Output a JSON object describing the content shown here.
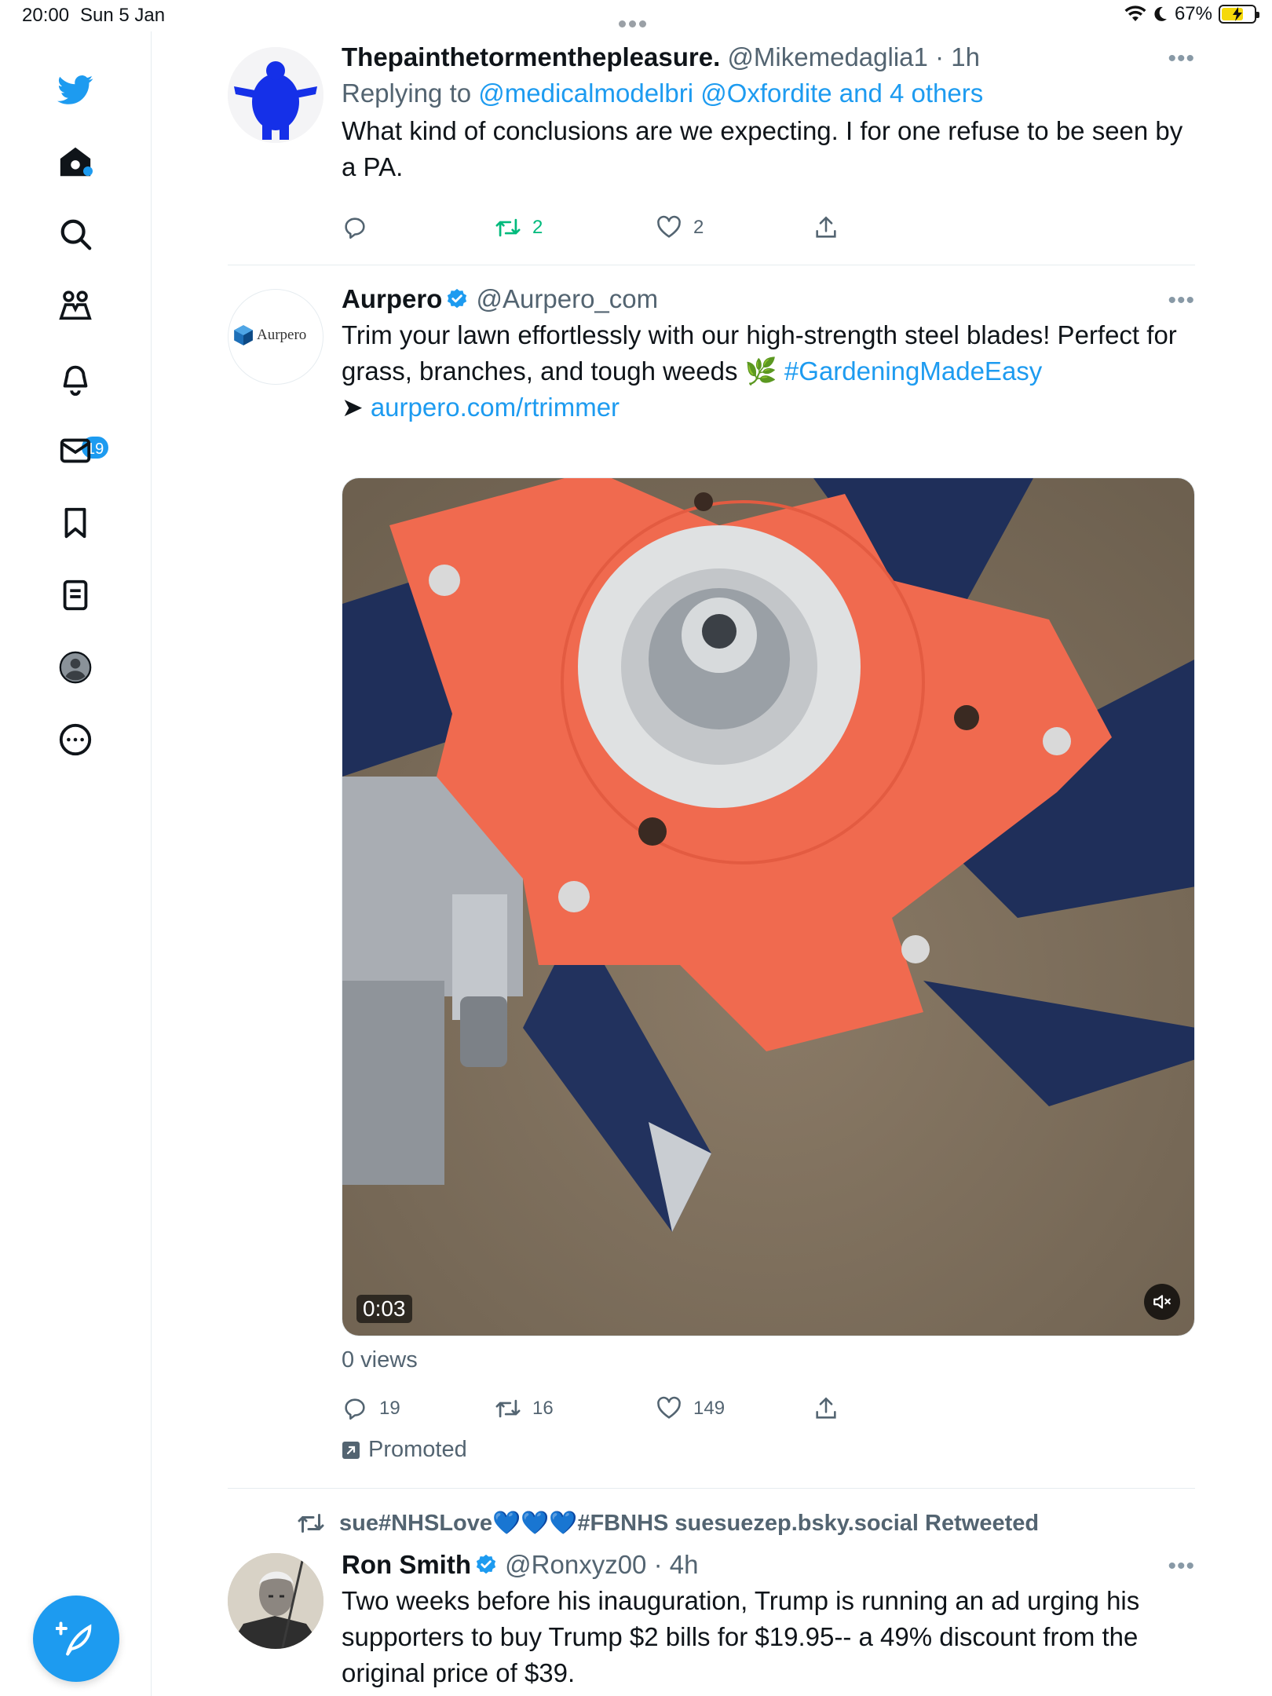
{
  "status_bar": {
    "time": "20:00",
    "date": "Sun 5 Jan",
    "battery": "67%",
    "battery_level": 0.67
  },
  "sidebar": {
    "items": [
      {
        "name": "logo",
        "icon": "twitter-bird-icon"
      },
      {
        "name": "home",
        "icon": "home-icon",
        "has_dot": true
      },
      {
        "name": "explore",
        "icon": "search-icon"
      },
      {
        "name": "communities",
        "icon": "communities-icon"
      },
      {
        "name": "notifications",
        "icon": "bell-icon",
        "badge": "19"
      },
      {
        "name": "messages",
        "icon": "mail-icon"
      },
      {
        "name": "bookmarks",
        "icon": "bookmark-icon"
      },
      {
        "name": "lists",
        "icon": "lists-icon"
      },
      {
        "name": "profile",
        "icon": "profile-icon"
      },
      {
        "name": "more",
        "icon": "more-circle-icon"
      }
    ],
    "compose_icon": "compose-feather-icon"
  },
  "tweets": [
    {
      "name": "Thepainthetormenthepleasure.",
      "handle": "@Mikemedaglia1",
      "time": "· 1h",
      "reply_prefix": "Replying to",
      "reply_targets": "@medicalmodelbri @Oxfordite and 4 others",
      "text": "What kind of conclusions are we expecting. I for one refuse to be seen by a PA.",
      "replies": "",
      "retweets": "2",
      "likes": "2"
    },
    {
      "name": "Aurpero",
      "avatar_text": "Aurpero",
      "handle": "@Aurpero_com",
      "text_1": "Trim your lawn effortlessly with our high-strength steel blades! Perfect for grass, branches, and tough weeds 🌿",
      "hashtag": "#GardeningMadeEasy",
      "arrow": "➤",
      "link": "aurpero.com/rtrimmer",
      "video_time": "0:03",
      "views": "0 views",
      "replies": "19",
      "retweets": "16",
      "likes": "149",
      "promoted": "Promoted"
    },
    {
      "retweeted_by": "sue#NHSLove💙💙💙#FBNHS suesuezep.bsky.social Retweeted",
      "name": "Ron Smith",
      "handle": "@Ronxyz00",
      "time": "· 4h",
      "text": "Two weeks before his inauguration, Trump is running an ad urging his supporters to buy Trump $2 bills for $19.95-- a 49% discount from the original price of $39."
    }
  ],
  "colors": {
    "accent": "#1d9bf0",
    "retweet_green": "#00ba7c",
    "secondary_text": "#536471",
    "divider": "#e6ecf0"
  }
}
